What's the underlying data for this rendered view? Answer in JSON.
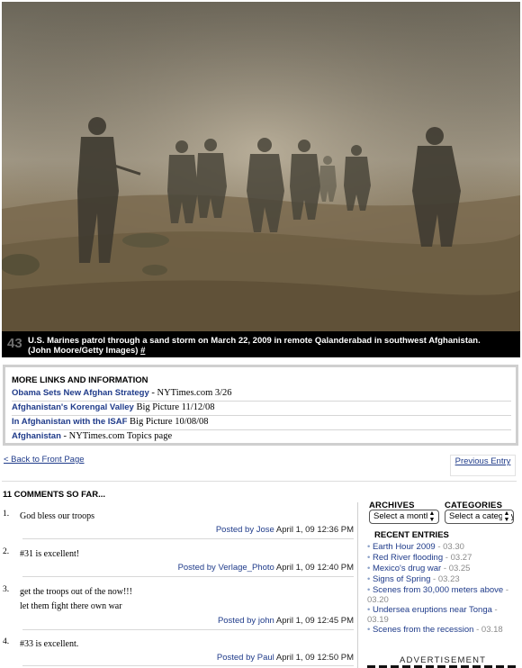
{
  "photo": {
    "number": "43",
    "caption": "U.S. Marines patrol through a sand storm on March 22, 2009 in remote Qalanderabad in southwest Afghanistan. (John Moore/Getty Images)",
    "permalink": "#"
  },
  "more_links": {
    "title": "MORE LINKS AND INFORMATION",
    "items": [
      {
        "link": "Obama Sets New Afghan Strategy",
        "source": " - NYTimes.com 3/26"
      },
      {
        "link": "Afghanistan's Korengal Valley",
        "source": " Big Picture 11/12/08"
      },
      {
        "link": "In Afghanistan with the ISAF",
        "source": " Big Picture 10/08/08"
      },
      {
        "link": "Afghanistan",
        "source": " - NYTimes.com Topics page"
      }
    ]
  },
  "nav": {
    "back": "< Back to Front Page",
    "previous": "Previous Entry"
  },
  "comments": {
    "title": "11 COMMENTS SO FAR...",
    "items": [
      {
        "num": "1.",
        "line1": "God bless our troops",
        "line2": "",
        "posted": "Posted by",
        "author": "Jose",
        "date": "April 1, 09 12:36 PM"
      },
      {
        "num": "2.",
        "line1": "#31 is excellent!",
        "line2": "",
        "posted": "Posted by",
        "author": "Verlage_Photo",
        "date": "April 1, 09 12:40 PM"
      },
      {
        "num": "3.",
        "line1": "get the troops out of the now!!!",
        "line2": "let them fight there own war",
        "posted": "Posted by",
        "author": "john",
        "date": "April 1, 09 12:45 PM"
      },
      {
        "num": "4.",
        "line1": "#33 is excellent.",
        "line2": "",
        "posted": "Posted by",
        "author": "Paul",
        "date": "April 1, 09 12:50 PM"
      }
    ]
  },
  "sidebar": {
    "archives_label": "ARCHIVES",
    "archives_select": "Select a month",
    "categories_label": "CATEGORIES",
    "categories_select": "Select a category",
    "recent_title": "RECENT ENTRIES",
    "recent": [
      {
        "title": "Earth Hour 2009",
        "date": "03.30"
      },
      {
        "title": "Red River flooding",
        "date": "03.27"
      },
      {
        "title": "Mexico's drug war",
        "date": "03.25"
      },
      {
        "title": "Signs of Spring",
        "date": "03.23"
      },
      {
        "title": "Scenes from 30,000 meters above",
        "date": "03.20"
      },
      {
        "title": "Undersea eruptions near Tonga",
        "date": "03.19"
      },
      {
        "title": "Scenes from the recession",
        "date": "03.18"
      }
    ],
    "ad_label": "ADVERTISEMENT"
  }
}
